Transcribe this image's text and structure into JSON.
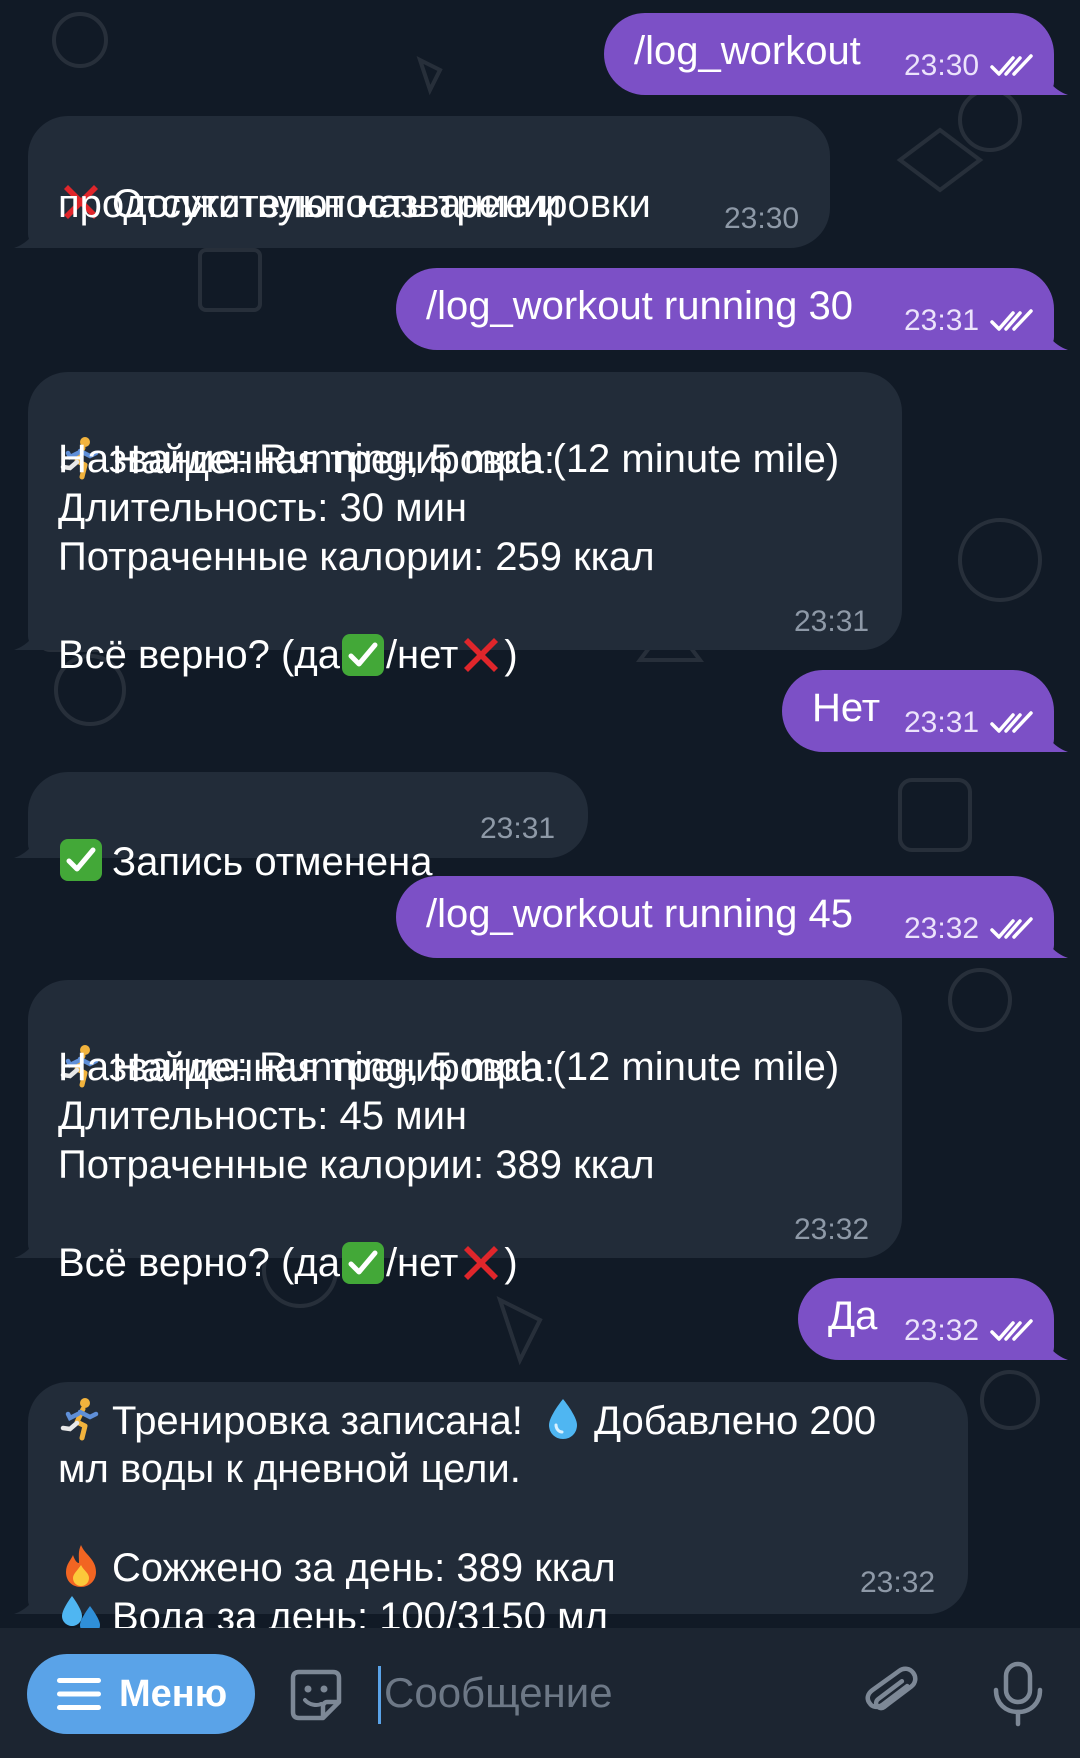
{
  "messages": [
    {
      "dir": "out",
      "text": "/log_workout",
      "time": "23:30"
    },
    {
      "dir": "in",
      "lines": [
        "Отсутствуют название и",
        "продолжительность тренировки"
      ],
      "time": "23:30"
    },
    {
      "dir": "out",
      "text": "/log_workout running 30",
      "time": "23:31"
    },
    {
      "dir": "in",
      "lines": [
        "Найденная тренировка:",
        "Название: Running, 5 mph (12 minute mile)",
        "Длительность: 30 мин",
        "Потраченные калории: 259 ккал",
        "Всё верно? (да",
        "/нет",
        ")"
      ],
      "time": "23:31"
    },
    {
      "dir": "out",
      "text": "Нет",
      "time": "23:31"
    },
    {
      "dir": "in",
      "lines": [
        "Запись отменена"
      ],
      "time": "23:31"
    },
    {
      "dir": "out",
      "text": "/log_workout running 45",
      "time": "23:32"
    },
    {
      "dir": "in",
      "lines": [
        "Найденная тренировка:",
        "Название: Running, 5 mph (12 minute mile)",
        "Длительность: 45 мин",
        "Потраченные калории: 389 ккал",
        "Всё верно? (да",
        "/нет",
        ")"
      ],
      "time": "23:32"
    },
    {
      "dir": "out",
      "text": "Да",
      "time": "23:32"
    },
    {
      "dir": "in",
      "lines": [
        "Тренировка записана!",
        "Добавлено 200",
        "мл воды к дневной цели.",
        "Сожжено за день: 389 ккал",
        "Вода за день: 100/3150 мл"
      ],
      "time": "23:32"
    }
  ],
  "input_bar": {
    "menu_label": "Меню",
    "placeholder": "Сообщение",
    "value": ""
  },
  "icons": {
    "menu": "hamburger-icon",
    "sticker": "sticker-icon",
    "attach": "paperclip-icon",
    "mic": "microphone-icon",
    "read": "double-check-icon",
    "cross": "red-cross-emoji",
    "check": "green-check-emoji",
    "runner": "runner-emoji",
    "droplet": "droplet-emoji",
    "fire": "fire-emoji",
    "sweat": "sweat-drops-emoji"
  },
  "colors": {
    "background": "#111a26",
    "incoming_bubble": "#222c39",
    "outgoing_bubble": "#7c50c6",
    "timestamp": "#8e99a7",
    "menu_button": "#5aa3e8",
    "input_bar": "#1c2531"
  }
}
